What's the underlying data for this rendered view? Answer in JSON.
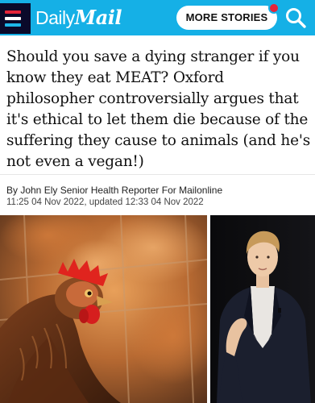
{
  "header": {
    "brand_daily": "Daily",
    "brand_mail": "Mail",
    "more_stories_label": "MORE STORIES",
    "menu_icon": "hamburger-menu-icon",
    "search_icon": "search-icon",
    "accent_color": "#15b0e6",
    "notification_color": "#e5253a"
  },
  "article": {
    "headline": "Should you save a dying stranger if you know they eat MEAT? Oxford philosopher controversially argues that it's ethical to let them die because of the suffering they cause to animals (and he's not even a vegan!)",
    "byline": "By John Ely Senior Health Reporter For Mailonline",
    "dateline": "11:25 04 Nov 2022, updated 12:33 04 Nov 2022"
  },
  "images": {
    "left": "chicken-photo",
    "right": "speaker-photo"
  }
}
